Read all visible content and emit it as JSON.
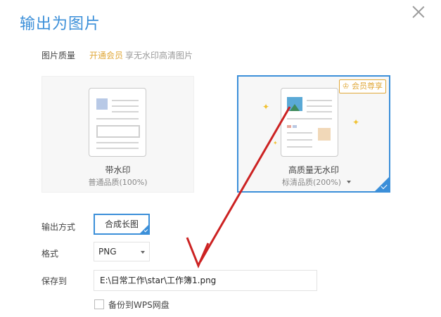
{
  "dialog": {
    "title": "输出为图片"
  },
  "quality": {
    "label": "图片质量",
    "vip_link": "开通会员",
    "vip_desc": "享无水印高清图片",
    "options": [
      {
        "title": "带水印",
        "subtitle": "普通品质(100%)"
      },
      {
        "title": "高质量无水印",
        "subtitle": "标清品质(200%)",
        "badge": "会员尊享"
      }
    ]
  },
  "output": {
    "mode_label": "输出方式",
    "mode_value": "合成长图",
    "format_label": "格式",
    "format_value": "PNG",
    "save_label": "保存到",
    "save_path": "E:\\日常工作\\star\\工作簿1.png",
    "backup_label": "备份到WPS网盘"
  },
  "colors": {
    "accent": "#3b8fd9",
    "vip": "#e0a83a",
    "arrow": "#cc2222"
  }
}
